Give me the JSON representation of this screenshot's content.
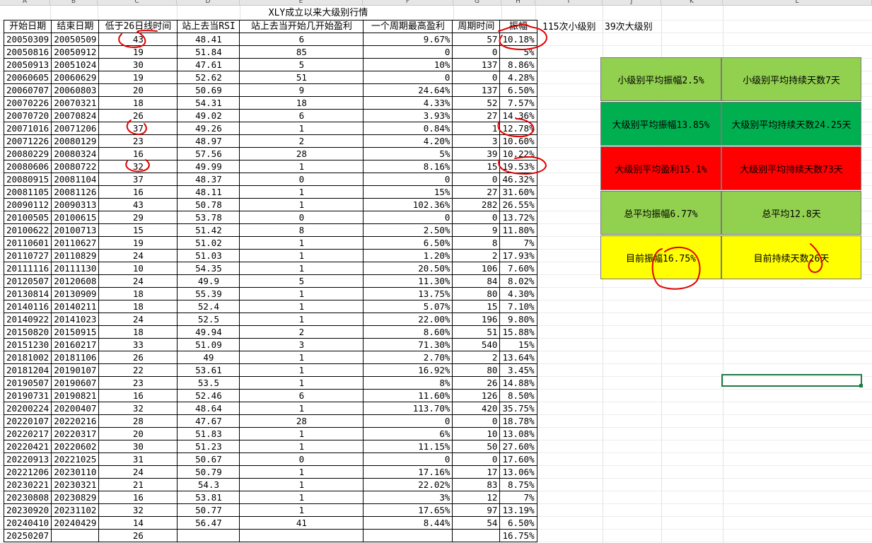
{
  "columns": [
    "A",
    "B",
    "C",
    "D",
    "E",
    "F",
    "G",
    "H",
    "I",
    "J",
    "K",
    "L"
  ],
  "title": "XLY成立以来大级别行情",
  "side_labels": {
    "small": "115次小级别",
    "large": "39次大级别"
  },
  "headers": [
    "开始日期",
    "结束日期",
    "低于26日线时间",
    "站上去当RSI",
    "站上去当开始几开始盈利",
    "一个周期最高盈利",
    "周期时间",
    "振幅"
  ],
  "rows": [
    [
      "20050309",
      "20050509",
      "43",
      "48.41",
      "6",
      "9.67%",
      "57",
      "10.18%"
    ],
    [
      "20050816",
      "20050912",
      "19",
      "51.84",
      "85",
      "0",
      "0",
      "5%"
    ],
    [
      "20050913",
      "20051024",
      "30",
      "47.61",
      "5",
      "10%",
      "137",
      "8.86%"
    ],
    [
      "20060605",
      "20060629",
      "19",
      "52.62",
      "51",
      "0",
      "0",
      "4.28%"
    ],
    [
      "20060707",
      "20060803",
      "20",
      "50.69",
      "9",
      "24.64%",
      "137",
      "6.50%"
    ],
    [
      "20070226",
      "20070321",
      "18",
      "54.31",
      "18",
      "4.33%",
      "52",
      "7.57%"
    ],
    [
      "20070720",
      "20070824",
      "26",
      "49.02",
      "6",
      "3.93%",
      "27",
      "14.36%"
    ],
    [
      "20071016",
      "20071206",
      "37",
      "49.26",
      "1",
      "0.84%",
      "1",
      "12.78%"
    ],
    [
      "20071226",
      "20080129",
      "23",
      "48.97",
      "2",
      "4.20%",
      "3",
      "10.60%"
    ],
    [
      "20080229",
      "20080324",
      "16",
      "57.56",
      "28",
      "5%",
      "39",
      "10.22%"
    ],
    [
      "20080606",
      "20080722",
      "32",
      "49.99",
      "1",
      "8.16%",
      "15",
      "19.53%"
    ],
    [
      "20080915",
      "20081104",
      "37",
      "48.37",
      "0",
      "0",
      "0",
      "46.32%"
    ],
    [
      "20081105",
      "20081126",
      "16",
      "48.11",
      "1",
      "15%",
      "27",
      "31.60%"
    ],
    [
      "20090112",
      "20090313",
      "43",
      "50.78",
      "1",
      "102.36%",
      "282",
      "26.55%"
    ],
    [
      "20100505",
      "20100615",
      "29",
      "53.78",
      "0",
      "0",
      "0",
      "13.72%"
    ],
    [
      "20100622",
      "20100713",
      "15",
      "51.42",
      "8",
      "2.50%",
      "9",
      "11.80%"
    ],
    [
      "20110601",
      "20110627",
      "19",
      "51.02",
      "1",
      "6.50%",
      "8",
      "7%"
    ],
    [
      "20110727",
      "20110829",
      "24",
      "51.03",
      "1",
      "1.20%",
      "2",
      "17.93%"
    ],
    [
      "20111116",
      "20111130",
      "10",
      "54.35",
      "1",
      "20.50%",
      "106",
      "7.60%"
    ],
    [
      "20120507",
      "20120608",
      "24",
      "49.9",
      "5",
      "11.30%",
      "84",
      "8.02%"
    ],
    [
      "20130814",
      "20130909",
      "18",
      "55.39",
      "1",
      "13.75%",
      "80",
      "4.30%"
    ],
    [
      "20140116",
      "20140211",
      "18",
      "52.4",
      "1",
      "5.07%",
      "15",
      "7.10%"
    ],
    [
      "20140922",
      "20141023",
      "24",
      "52.5",
      "1",
      "22.00%",
      "196",
      "9.80%"
    ],
    [
      "20150820",
      "20150915",
      "18",
      "49.94",
      "2",
      "8.60%",
      "51",
      "15.88%"
    ],
    [
      "20151230",
      "20160217",
      "33",
      "51.09",
      "3",
      "71.30%",
      "540",
      "15%"
    ],
    [
      "20181002",
      "20181106",
      "26",
      "49",
      "1",
      "2.70%",
      "2",
      "13.64%"
    ],
    [
      "20181204",
      "20190107",
      "22",
      "53.61",
      "1",
      "16.92%",
      "80",
      "3.45%"
    ],
    [
      "20190507",
      "20190607",
      "23",
      "53.5",
      "1",
      "8%",
      "26",
      "14.88%"
    ],
    [
      "20190731",
      "20190821",
      "16",
      "52.46",
      "6",
      "11.60%",
      "126",
      "8.50%"
    ],
    [
      "20200224",
      "20200407",
      "32",
      "48.64",
      "1",
      "113.70%",
      "420",
      "35.75%"
    ],
    [
      "20220107",
      "20220216",
      "28",
      "47.67",
      "28",
      "0",
      "0",
      "18.78%"
    ],
    [
      "20220217",
      "20220317",
      "20",
      "51.83",
      "1",
      "6%",
      "10",
      "13.08%"
    ],
    [
      "20220421",
      "20220602",
      "30",
      "51.23",
      "1",
      "11.15%",
      "50",
      "27.60%"
    ],
    [
      "20220913",
      "20221025",
      "31",
      "50.67",
      "0",
      "0",
      "0",
      "17.60%"
    ],
    [
      "20221206",
      "20230110",
      "24",
      "50.79",
      "1",
      "17.16%",
      "17",
      "13.06%"
    ],
    [
      "20230221",
      "20230321",
      "21",
      "54.3",
      "1",
      "22.02%",
      "83",
      "8.75%"
    ],
    [
      "20230808",
      "20230829",
      "16",
      "53.81",
      "1",
      "3%",
      "12",
      "7%"
    ],
    [
      "20230920",
      "20231102",
      "32",
      "50.77",
      "1",
      "17.65%",
      "97",
      "13.19%"
    ],
    [
      "20240410",
      "20240429",
      "14",
      "56.47",
      "41",
      "8.44%",
      "54",
      "6.50%"
    ],
    [
      "20250207",
      "",
      "26",
      "",
      "",
      "",
      "",
      "16.75%"
    ]
  ],
  "summary": [
    {
      "color": "#92d050",
      "left": "小级别平均振幅2.5%",
      "right": "小级别平均持续天数7天",
      "text_color": "#000000"
    },
    {
      "color": "#00b050",
      "left": "大级别平均振幅13.85%",
      "right": "大级别平均持续天数24.25天",
      "text_color": "#000000"
    },
    {
      "color": "#ff0000",
      "left": "大级别平均盈利15.1%",
      "right": "大级别平均持续天数73天",
      "text_color": "#000000"
    },
    {
      "color": "#92d050",
      "left": "总平均振幅6.77%",
      "right": "总平均12.8天",
      "text_color": "#000000"
    },
    {
      "color": "#ffff00",
      "left": "目前振幅16.75%",
      "right": "目前持续天数26天",
      "text_color": "#000000"
    }
  ],
  "annotation_color": "#e00000"
}
